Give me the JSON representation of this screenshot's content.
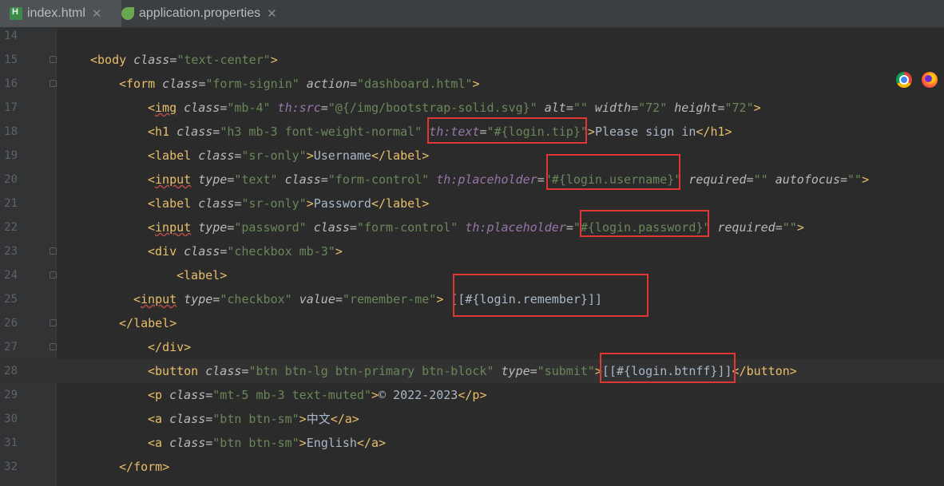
{
  "tabs": [
    {
      "label": "index.html",
      "icon": "html-file-icon",
      "active": true
    },
    {
      "label": "application.properties",
      "icon": "spring-leaf-icon",
      "active": false
    }
  ],
  "close_glyph": "✕",
  "line_numbers": [
    "14",
    "15",
    "16",
    "17",
    "18",
    "19",
    "20",
    "21",
    "22",
    "23",
    "24",
    "25",
    "26",
    "27",
    "28",
    "29",
    "30",
    "31",
    "32"
  ],
  "current_line": "28",
  "browser_icons": [
    "chrome-icon",
    "firefox-icon"
  ],
  "lines": [
    {
      "num": "15",
      "tokens": [
        "<",
        "body",
        " class",
        "=",
        "\"text-center\"",
        ">"
      ]
    },
    {
      "num": "16",
      "tokens": [
        "<",
        "form",
        " class",
        "=",
        "\"form-signin\"",
        " action",
        "=",
        "\"dashboard.html\"",
        ">"
      ]
    },
    {
      "num": "17",
      "tokens": [
        "<",
        "img",
        " class",
        "=",
        "\"mb-4\"",
        " th:src",
        "=",
        "\"@{/img/bootstrap-solid.svg}\"",
        " alt",
        "=",
        "\"\"",
        " width",
        "=",
        "\"72\"",
        " height",
        "=",
        "\"72\"",
        ">"
      ]
    },
    {
      "num": "18",
      "tokens": [
        "<",
        "h1",
        " class",
        "=",
        "\"h3 mb-3 font-weight-normal\"",
        " th:text",
        "=",
        "\"#{login.tip}\"",
        ">",
        "Please sign in",
        "</",
        "h1",
        ">"
      ]
    },
    {
      "num": "19",
      "tokens": [
        "<",
        "label",
        " class",
        "=",
        "\"sr-only\"",
        ">",
        "Username",
        "</",
        "label",
        ">"
      ]
    },
    {
      "num": "20",
      "tokens": [
        "<",
        "input",
        " type",
        "=",
        "\"text\"",
        " class",
        "=",
        "\"form-control\"",
        " th:placeholder",
        "=",
        "\"#{login.username}\"",
        " required",
        "=",
        "\"\"",
        " autofocus",
        "=",
        "\"\"",
        ">"
      ]
    },
    {
      "num": "21",
      "tokens": [
        "<",
        "label",
        " class",
        "=",
        "\"sr-only\"",
        ">",
        "Password",
        "</",
        "label",
        ">"
      ]
    },
    {
      "num": "22",
      "tokens": [
        "<",
        "input",
        " type",
        "=",
        "\"password\"",
        " class",
        "=",
        "\"form-control\"",
        " th:placeholder",
        "=",
        "\"#{login.password}\"",
        " required",
        "=",
        "\"\"",
        ">"
      ]
    },
    {
      "num": "23",
      "tokens": [
        "<",
        "div",
        " class",
        "=",
        "\"checkbox mb-3\"",
        ">"
      ]
    },
    {
      "num": "24",
      "tokens": [
        "<",
        "label",
        ">"
      ]
    },
    {
      "num": "25",
      "tokens": [
        "<",
        "input",
        " type",
        "=",
        "\"checkbox\"",
        " value",
        "=",
        "\"remember-me\"",
        "> ",
        "[[#{login.remember}]]"
      ]
    },
    {
      "num": "26",
      "tokens": [
        "</",
        "label",
        ">"
      ]
    },
    {
      "num": "27",
      "tokens": [
        "</",
        "div",
        ">"
      ]
    },
    {
      "num": "28",
      "tokens": [
        "<",
        "button",
        " class",
        "=",
        "\"btn btn-lg btn-primary btn-block\"",
        " type",
        "=",
        "\"submit\"",
        ">",
        "[[#{login.btnff}]]",
        "</",
        "button",
        ">"
      ]
    },
    {
      "num": "29",
      "tokens": [
        "<",
        "p",
        " class",
        "=",
        "\"mt-5 mb-3 text-muted\"",
        ">",
        "© 2022-2023",
        "</",
        "p",
        ">"
      ]
    },
    {
      "num": "30",
      "tokens": [
        "<",
        "a",
        " class",
        "=",
        "\"btn btn-sm\"",
        ">",
        "中文",
        "</",
        "a",
        ">"
      ]
    },
    {
      "num": "31",
      "tokens": [
        "<",
        "a",
        " class",
        "=",
        "\"btn btn-sm\"",
        ">",
        "English",
        "</",
        "a",
        ">"
      ]
    },
    {
      "num": "32",
      "tokens": [
        "</",
        "form",
        ">"
      ]
    }
  ]
}
